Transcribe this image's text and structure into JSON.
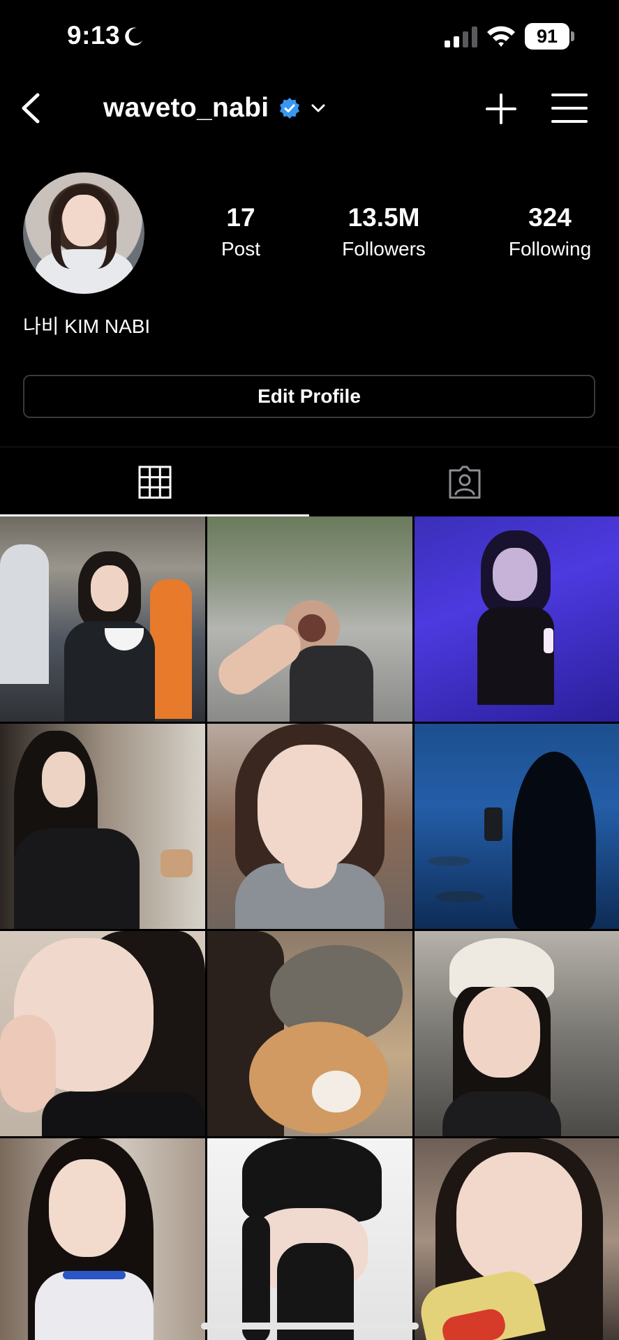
{
  "status_bar": {
    "time": "9:13",
    "battery": "91",
    "icons": [
      "moon-icon",
      "cellular-signal-icon",
      "wifi-icon",
      "battery-icon"
    ]
  },
  "header": {
    "username": "waveto_nabi",
    "verified": true,
    "icons": [
      "back-chevron-icon",
      "verified-badge-icon",
      "chevron-down-icon",
      "plus-icon",
      "hamburger-menu-icon"
    ]
  },
  "profile": {
    "display_name": "나비 KIM NABI",
    "stats": {
      "posts_value": "17",
      "posts_label": "Post",
      "followers_value": "13.5M",
      "followers_label": "Followers",
      "following_value": "324",
      "following_label": "Following"
    },
    "edit_button": "Edit Profile"
  },
  "tabs": [
    {
      "icon": "grid-icon",
      "active": true
    },
    {
      "icon": "tagged-person-icon",
      "active": false
    }
  ],
  "grid": {
    "rows": 4,
    "columns": 3,
    "posts": [
      {
        "subject": "girl holding bowl in crowd"
      },
      {
        "subject": "fisheye selfie on street"
      },
      {
        "subject": "concert purple light"
      },
      {
        "subject": "girl in black tee indoors"
      },
      {
        "subject": "close-up portrait"
      },
      {
        "subject": "aquarium silhouette"
      },
      {
        "subject": "hand on cheek portrait"
      },
      {
        "subject": "two cats"
      },
      {
        "subject": "white beanie selfie"
      },
      {
        "subject": "long hair selfie"
      },
      {
        "subject": "black beanie selfie"
      },
      {
        "subject": "selfie with snack"
      }
    ]
  },
  "colors": {
    "background": "#000000",
    "text": "#ffffff",
    "verified_blue": "#3897f0",
    "border": "#3a3a3c"
  }
}
